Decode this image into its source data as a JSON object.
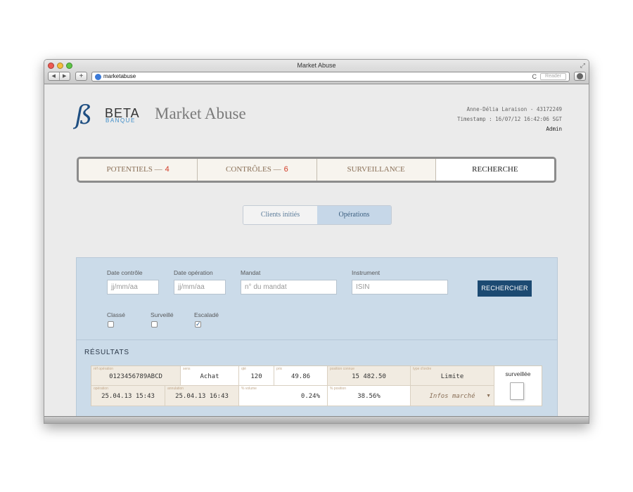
{
  "browser": {
    "window_title": "Market Abuse",
    "url": "marketabuse",
    "reader_label": "Reader",
    "plus_label": "+",
    "back_label": "◀",
    "forward_label": "▶",
    "reload_label": "C",
    "resize_label": "⤢"
  },
  "header": {
    "logo_mark": "ß",
    "logo_name": "BETA",
    "logo_sub": "BANQUE",
    "app_title": "Market Abuse",
    "user_line": "Anne-Délia Laraison - 43172249",
    "timestamp": "Timestamp : 16/07/12 16:42:06 SGT",
    "role": "Admin"
  },
  "main_tabs": [
    {
      "label": "POTENTIELS —",
      "count": "4"
    },
    {
      "label": "CONTRÔLES —",
      "count": "6"
    },
    {
      "label": "SURVEILLANCE",
      "count": ""
    },
    {
      "label": "RECHERCHE",
      "count": "",
      "active": true
    }
  ],
  "sub_tabs": [
    {
      "label": "Clients initiés"
    },
    {
      "label": "Opérations",
      "active": true
    }
  ],
  "search": {
    "date_controle": {
      "label": "Date contrôle",
      "placeholder": "jj/mm/aa"
    },
    "date_operation": {
      "label": "Date opération",
      "placeholder": "jj/mm/aa"
    },
    "mandat": {
      "label": "Mandat",
      "placeholder": "n° du mandat"
    },
    "instrument": {
      "label": "Instrument",
      "placeholder": "ISIN"
    },
    "button": "RECHERCHER",
    "checkboxes": [
      {
        "label": "Classé",
        "checked": false,
        "mark": ""
      },
      {
        "label": "Surveillé",
        "checked": false,
        "mark": ""
      },
      {
        "label": "Escaladé",
        "checked": true,
        "mark": "✓"
      }
    ]
  },
  "results": {
    "title": "RÉSULTATS",
    "row1": [
      {
        "label": "réf opération",
        "value": "0123456789ABCD"
      },
      {
        "label": "sens",
        "value": "Achat"
      },
      {
        "label": "qté",
        "value": "120"
      },
      {
        "label": "prix",
        "value": "49.86"
      },
      {
        "label": "position connue",
        "value": "15 482.50"
      },
      {
        "label": "type d'ordre",
        "value": "Limite"
      }
    ],
    "row2": [
      {
        "label": "opération",
        "value": "25.04.13 15:43"
      },
      {
        "label": "annulation",
        "value": "25.04.13 16:43"
      },
      {
        "label": "% volume",
        "value": "0.24%"
      },
      {
        "label": "% position",
        "value": "38.56%"
      },
      {
        "label": "",
        "value": "Infos marché"
      }
    ],
    "caret": "▼",
    "surveillee_label": "surveillée"
  }
}
